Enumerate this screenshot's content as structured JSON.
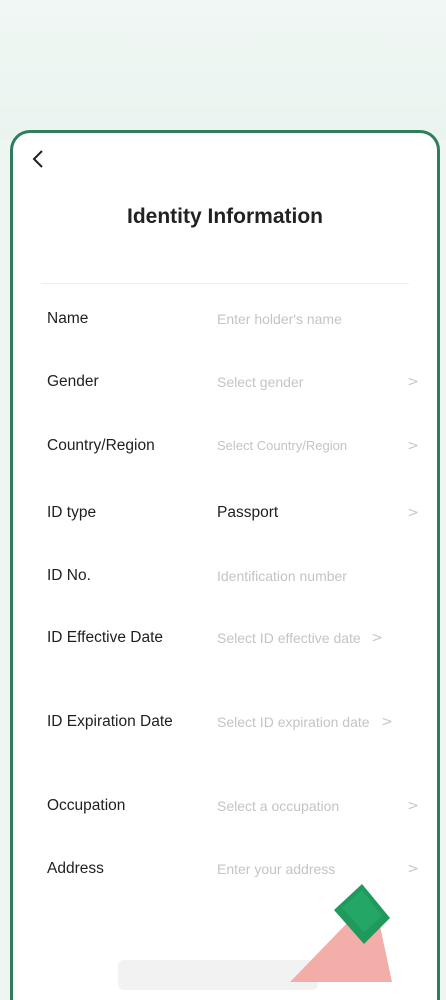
{
  "header": {
    "back_icon": "chevron-left-icon",
    "title": "Identity Information"
  },
  "form": {
    "rows": [
      {
        "label": "Name",
        "value": "Enter holder's name",
        "filled": false,
        "chevron": false
      },
      {
        "label": "Gender",
        "value": "Select gender",
        "filled": false,
        "chevron": true
      },
      {
        "label": "Country/Region",
        "value": "Select Country/Region",
        "filled": false,
        "chevron": true
      },
      {
        "label": "ID type",
        "value": "Passport",
        "filled": true,
        "chevron": true
      },
      {
        "label": "ID No.",
        "value": "Identification number",
        "filled": false,
        "chevron": false
      },
      {
        "label": "ID Effective Date",
        "value": "Select ID effective date",
        "filled": false,
        "chevron": true
      },
      {
        "label": "ID Expiration Date",
        "value": "Select ID expiration date",
        "filled": false,
        "chevron": true
      },
      {
        "label": "Occupation",
        "value": "Select a occupation",
        "filled": false,
        "chevron": true
      },
      {
        "label": "Address",
        "value": "Enter your address",
        "filled": false,
        "chevron": true
      }
    ],
    "chevron_glyph": ">"
  },
  "colors": {
    "accent": "#2e7d5b",
    "pointer_green": "#1f9a5c",
    "pointer_pink": "#f2a7a3"
  }
}
